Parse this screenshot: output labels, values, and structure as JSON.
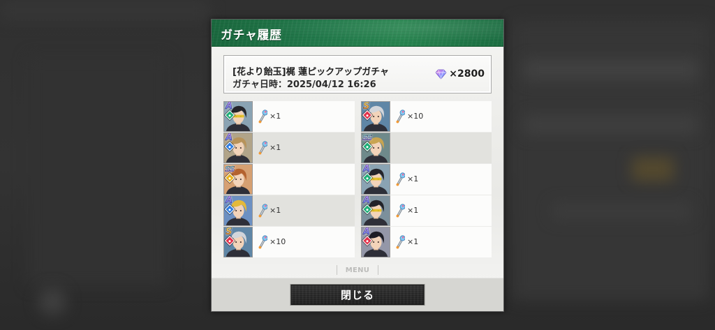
{
  "dialog": {
    "title": "ガチャ履歴",
    "gacha": {
      "name": "[花より飴玉]梶 蓮ピックアップガチャ",
      "date_label": "ガチャ日時：",
      "date_value": "2025/04/12 16:26",
      "cost_icon": "gem-icon",
      "cost": "×2800"
    },
    "results": [
      {
        "rarity": "A",
        "element_icon": "green-attribute-icon",
        "element_color": "#1fae78",
        "portrait": {
          "icon": "character-portrait-icon",
          "hair": "#24242a",
          "backdrop": "#8aa3b3",
          "accent": "#e3c020"
        },
        "reward_icon": "penlight-icon",
        "reward_count": "×1"
      },
      {
        "rarity": "S",
        "element_icon": "red-attribute-icon",
        "element_color": "#e2334c",
        "portrait": {
          "icon": "character-portrait-icon",
          "hair": "#d2d5da",
          "backdrop": "#5f86a6"
        },
        "reward_icon": "penlight-icon",
        "reward_count": "×10"
      },
      {
        "rarity": "A",
        "element_icon": "blue-attribute-icon",
        "element_color": "#2f7ee3",
        "portrait": {
          "icon": "character-portrait-icon",
          "hair": "#b8935a",
          "backdrop": "#b1a489"
        },
        "reward_icon": "penlight-icon",
        "reward_count": "×1"
      },
      {
        "rarity": "SS",
        "element_icon": "green-attribute-icon",
        "element_color": "#1fae78",
        "portrait": {
          "icon": "character-portrait-icon",
          "hair": "#c8a451",
          "backdrop": "#6f8a8b"
        }
      },
      {
        "rarity": "SS",
        "element_icon": "yellow-attribute-icon",
        "element_color": "#e9b31d",
        "portrait": {
          "icon": "character-portrait-icon",
          "hair": "#b4622f",
          "backdrop": "#d6a072"
        }
      },
      {
        "rarity": "A",
        "element_icon": "green-attribute-icon",
        "element_color": "#1fae78",
        "portrait": {
          "icon": "character-portrait-icon",
          "hair": "#24242a",
          "backdrop": "#8aa3b3",
          "accent": "#e3c020"
        },
        "reward_icon": "penlight-icon",
        "reward_count": "×1"
      },
      {
        "rarity": "A",
        "element_icon": "blue-attribute-icon",
        "element_color": "#2f7ee3",
        "portrait": {
          "icon": "character-portrait-icon",
          "hair": "#e4b93a",
          "backdrop": "#6c90c2"
        },
        "reward_icon": "penlight-icon",
        "reward_count": "×1"
      },
      {
        "rarity": "A",
        "element_icon": "green-attribute-icon",
        "element_color": "#1fae78",
        "portrait": {
          "icon": "character-portrait-icon",
          "hair": "#222228",
          "backdrop": "#7c909c",
          "accent": "#e3c020"
        },
        "reward_icon": "penlight-icon",
        "reward_count": "×1"
      },
      {
        "rarity": "S",
        "element_icon": "red-attribute-icon",
        "element_color": "#e2334c",
        "portrait": {
          "icon": "character-portrait-icon",
          "hair": "#d2d5da",
          "backdrop": "#5f86a6"
        },
        "reward_icon": "penlight-icon",
        "reward_count": "×10"
      },
      {
        "rarity": "A",
        "element_icon": "red-attribute-icon",
        "element_color": "#e2334c",
        "portrait": {
          "icon": "character-portrait-icon",
          "hair": "#1d1d25",
          "backdrop": "#9497a8"
        },
        "reward_icon": "penlight-icon",
        "reward_count": "×1"
      }
    ],
    "menu_label": "MENU",
    "close_label": "閉じる"
  },
  "colors": {
    "rarity": {
      "A": [
        "#c39bff",
        "#4d72e6"
      ],
      "S": [
        "#ffea70",
        "#f0861a"
      ],
      "SS": [
        "#86f5bf",
        "#c07bff"
      ]
    }
  }
}
